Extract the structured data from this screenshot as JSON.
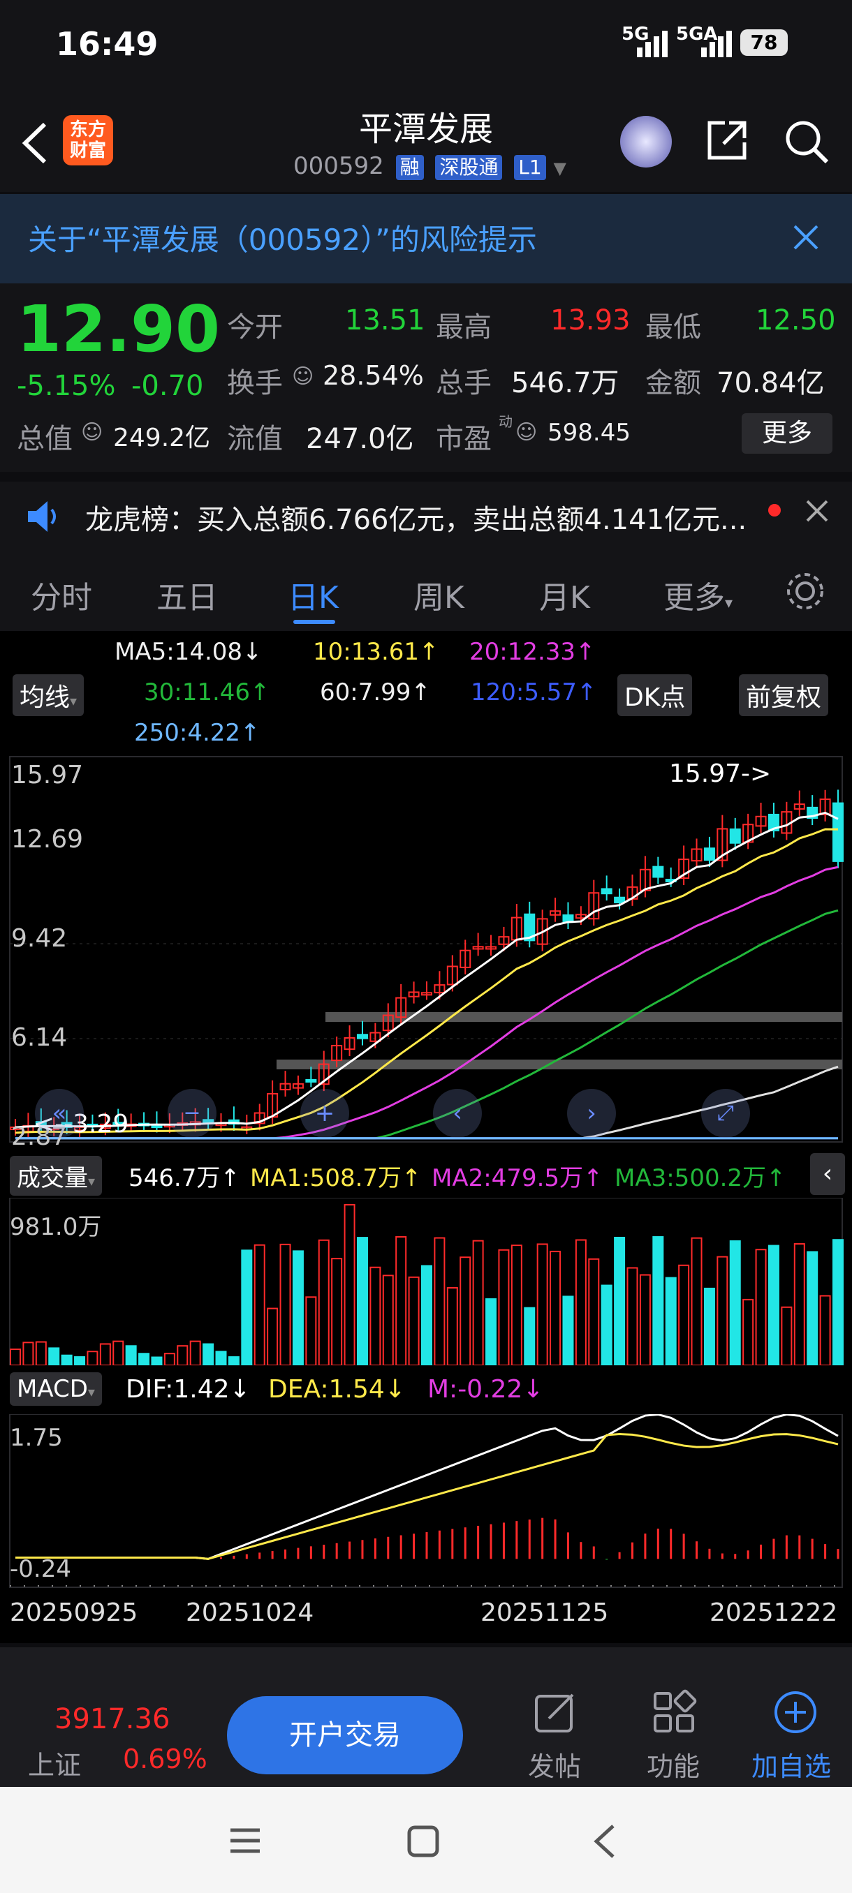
{
  "status": {
    "time": "16:49",
    "signal1": "5G",
    "signal2": "5GA",
    "battery": "78"
  },
  "header": {
    "logo_text": "东方\n财富",
    "title": "平潭发展",
    "code": "000592",
    "tags": [
      "融",
      "深股通",
      "L1"
    ]
  },
  "risk_banner": {
    "text": "关于“平潭发展（000592）”的风险提示"
  },
  "quote": {
    "price": "12.90",
    "change_pct": "-5.15%",
    "change": "-0.70",
    "open_label": "今开",
    "open": "13.51",
    "high_label": "最高",
    "high": "13.93",
    "low_label": "最低",
    "low": "12.50",
    "turnover_label": "换手",
    "turnover": "28.54%",
    "volume_label": "总手",
    "volume": "546.7万",
    "amount_label": "金额",
    "amount": "70.84亿",
    "mcap_label": "总值",
    "mcap": "249.2亿",
    "float_label": "流值",
    "float": "247.0亿",
    "pe_label": "市盈",
    "pe_sup": "动",
    "pe": "598.45",
    "more": "更多"
  },
  "notice": {
    "text": "龙虎榜：买入总额6.766亿元，卖出总额4.141亿元..."
  },
  "tabs": [
    "分时",
    "五日",
    "日K",
    "周K",
    "月K",
    "更多"
  ],
  "ma_panel": {
    "selector": "均线",
    "ma5": "MA5:14.08↓",
    "ma10": "10:13.61↑",
    "ma20": "20:12.33↑",
    "ma30": "30:11.46↑",
    "ma60": "60:7.99↑",
    "ma120": "120:5.57↑",
    "ma250": "250:4.22↑",
    "dk": "DK点",
    "adjust": "前复权"
  },
  "price_axis": [
    "15.97",
    "12.69",
    "9.42",
    "6.14",
    "2.87"
  ],
  "annotations": {
    "high": "15.97->",
    "low": "<--3.29"
  },
  "volume_panel": {
    "selector": "成交量",
    "vol": "546.7万↑",
    "ma1": "MA1:508.7万↑",
    "ma2": "MA2:479.5万↑",
    "ma3": "MA3:500.2万↑",
    "axis_top": "981.0万"
  },
  "macd_panel": {
    "selector": "MACD",
    "dif": "DIF:1.42↓",
    "dea": "DEA:1.54↓",
    "m": "M:-0.22↓",
    "axis_top": "1.75",
    "axis_bottom": "-0.24"
  },
  "dates": [
    "20250925",
    "20251024",
    "20251125",
    "20251222"
  ],
  "bottom": {
    "index_value": "3917.36",
    "index_name": "上证",
    "index_change": "0.69%",
    "open_account": "开户交易",
    "post": "发帖",
    "func": "功能",
    "add": "加自选"
  },
  "chart_data": {
    "type": "candlestick",
    "ohlc_sample": [
      {
        "date": "20250925",
        "close": 3.3
      },
      {
        "date": "20251024",
        "close": 3.6
      },
      {
        "date": "20251125",
        "close": 10.6
      },
      {
        "date": "20251222",
        "close": 12.9
      }
    ],
    "period_high": 15.97,
    "period_low": 3.29
  },
  "colors": {
    "up": "#ff2a2a",
    "down": "#22e6e6",
    "ma5": "#ffffff",
    "ma10": "#ffe94a",
    "ma20": "#e23de2",
    "ma30": "#22b83a",
    "ma120": "#3d5dff",
    "ma250": "#6fb8ff"
  }
}
